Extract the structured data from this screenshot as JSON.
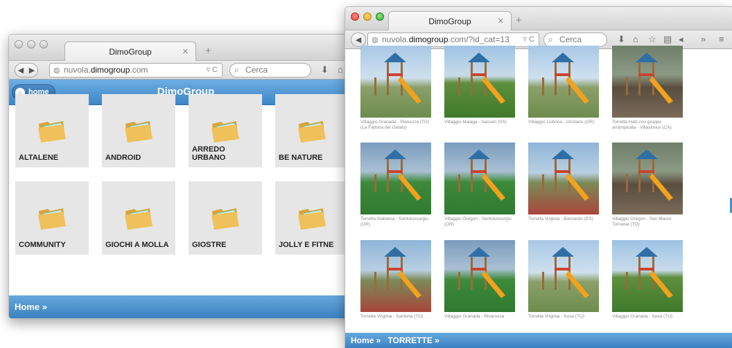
{
  "colors": {
    "accent": "#3e86c6",
    "footer": "#3b82c2"
  },
  "left_window": {
    "tab_title": "DimoGroup",
    "url_prefix": "nuvola.",
    "url_domain": "dimogroup",
    "url_suffix": ".com",
    "search_placeholder": "Cerca",
    "home_label": "home",
    "app_title": "DimoGroup",
    "folders": [
      {
        "label": "ALTALENE"
      },
      {
        "label": "ANDROID"
      },
      {
        "label": "ARREDO\nURBANO"
      },
      {
        "label": "BE NATURE"
      },
      {
        "label": "COMMUNITY"
      },
      {
        "label": "GIOCHI A MOLLA"
      },
      {
        "label": "GIOSTRE"
      },
      {
        "label": "JOLLY E FITNE"
      }
    ],
    "footer": "Home »"
  },
  "right_window": {
    "tab_title": "DimoGroup",
    "url_prefix": "nuvola.",
    "url_domain": "dimogroup",
    "url_suffix": ".com/?id_cat=13",
    "search_placeholder": "Cerca",
    "photos": [
      {
        "caption": "Villaggio Granada - Pianezza (TO) (La Fattoria del Gelato)"
      },
      {
        "caption": "Villaggio Malaga - Sassari (SS)"
      },
      {
        "caption": "Villaggio Lisbona - Oristano (OR)"
      },
      {
        "caption": "Torretta Haiti con gruppo arrampicata - Villasimius (CA)"
      },
      {
        "caption": "Torretta Alabama - Santulussurgiu (OR)"
      },
      {
        "caption": "Villaggio Oregon - Santulussurgiu (OR)"
      },
      {
        "caption": "Torretta Virginia - Barisardo (ES)"
      },
      {
        "caption": "Villaggio Oregon - San Mauro Torinese (TO)"
      },
      {
        "caption": "Torretta Virginia - Santena (TO)"
      },
      {
        "caption": "Villaggio Granada - Rivarossa"
      },
      {
        "caption": "Torretta Virginia - Susa (TO)"
      },
      {
        "caption": "Villaggio Granada - Susa (TO)"
      }
    ],
    "breadcrumb_home": "Home »",
    "breadcrumb_current": "TORRETTE »"
  }
}
